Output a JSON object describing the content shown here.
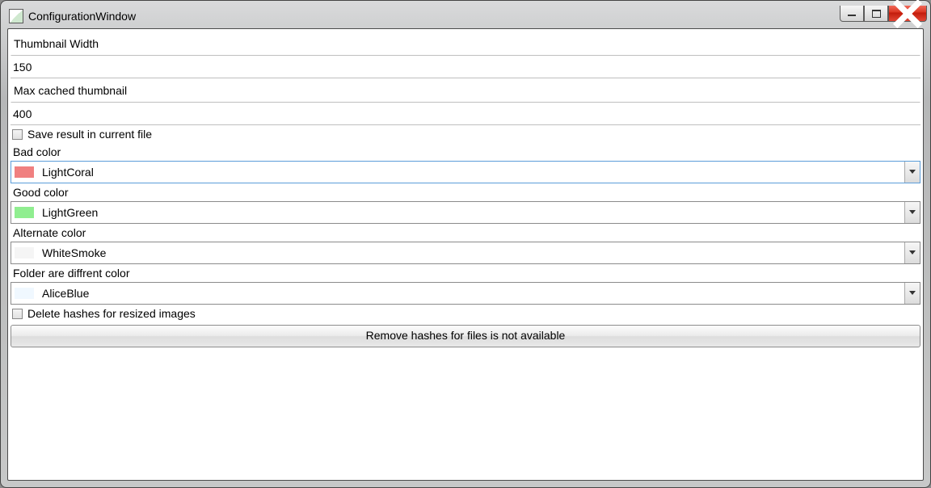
{
  "window": {
    "title": "ConfigurationWindow"
  },
  "labels": {
    "thumb_width": "Thumbnail Width",
    "max_cached": "Max cached thumbnail",
    "save_result": "Save result in current file",
    "bad_color": "Bad color",
    "good_color": "Good color",
    "alternate_color": "Alternate color",
    "folder_diff": "Folder are diffrent color",
    "delete_hashes": "Delete hashes for resized images"
  },
  "values": {
    "thumb_width": "150",
    "max_cached": "400",
    "save_result_checked": false,
    "delete_hashes_checked": false
  },
  "colors": {
    "bad": {
      "name": "LightCoral",
      "hex": "#F08080"
    },
    "good": {
      "name": "LightGreen",
      "hex": "#90EE90"
    },
    "alternate": {
      "name": "WhiteSmoke",
      "hex": "#F5F5F5"
    },
    "folder": {
      "name": "AliceBlue",
      "hex": "#F0F8FF"
    }
  },
  "buttons": {
    "remove_hashes": "Remove hashes for files is not available"
  }
}
